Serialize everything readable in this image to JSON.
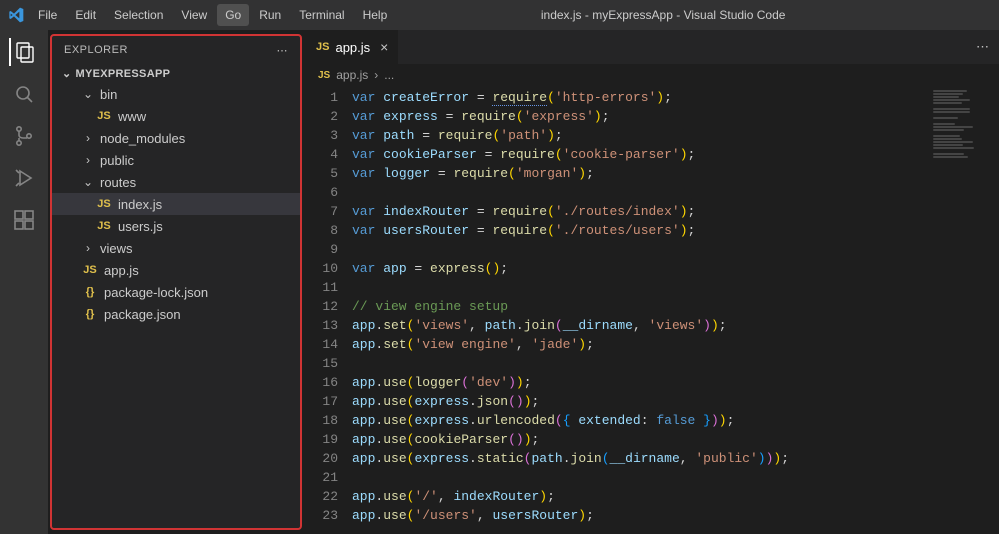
{
  "titlebar": {
    "menus": [
      "File",
      "Edit",
      "Selection",
      "View",
      "Go",
      "Run",
      "Terminal",
      "Help"
    ],
    "active_menu": "Go",
    "title": "index.js - myExpressApp - Visual Studio Code"
  },
  "activitybar": {
    "items": [
      {
        "name": "explorer",
        "active": true
      },
      {
        "name": "search",
        "active": false
      },
      {
        "name": "source-control",
        "active": false
      },
      {
        "name": "run-debug",
        "active": false
      },
      {
        "name": "extensions",
        "active": false
      }
    ]
  },
  "sidebar": {
    "title": "EXPLORER",
    "project": "MYEXPRESSAPP",
    "tree": [
      {
        "type": "folder",
        "name": "bin",
        "open": true,
        "depth": 1
      },
      {
        "type": "file",
        "name": "www",
        "lang": "js",
        "depth": 2
      },
      {
        "type": "folder",
        "name": "node_modules",
        "open": false,
        "depth": 1
      },
      {
        "type": "folder",
        "name": "public",
        "open": false,
        "depth": 1
      },
      {
        "type": "folder",
        "name": "routes",
        "open": true,
        "depth": 1
      },
      {
        "type": "file",
        "name": "index.js",
        "lang": "js",
        "depth": 2,
        "selected": true
      },
      {
        "type": "file",
        "name": "users.js",
        "lang": "js",
        "depth": 2
      },
      {
        "type": "folder",
        "name": "views",
        "open": false,
        "depth": 1
      },
      {
        "type": "file",
        "name": "app.js",
        "lang": "js",
        "depth": 1
      },
      {
        "type": "file",
        "name": "package-lock.json",
        "lang": "json",
        "depth": 1
      },
      {
        "type": "file",
        "name": "package.json",
        "lang": "json",
        "depth": 1
      }
    ]
  },
  "tabs": {
    "open": [
      {
        "label": "app.js",
        "lang": "js",
        "active": true
      }
    ]
  },
  "breadcrumb": {
    "file": "app.js",
    "sep": "›",
    "rest": "..."
  },
  "code": {
    "start_line": 1,
    "lines": [
      [
        [
          "kw",
          "var"
        ],
        [
          "p",
          " "
        ],
        [
          "var",
          "createError"
        ],
        [
          "p",
          " = "
        ],
        [
          "fn-sq",
          "require"
        ],
        [
          "brk1",
          "("
        ],
        [
          "str",
          "'http-errors'"
        ],
        [
          "brk1",
          ")"
        ],
        [
          "p",
          ";"
        ]
      ],
      [
        [
          "kw",
          "var"
        ],
        [
          "p",
          " "
        ],
        [
          "var",
          "express"
        ],
        [
          "p",
          " = "
        ],
        [
          "fn",
          "require"
        ],
        [
          "brk1",
          "("
        ],
        [
          "str",
          "'express'"
        ],
        [
          "brk1",
          ")"
        ],
        [
          "p",
          ";"
        ]
      ],
      [
        [
          "kw",
          "var"
        ],
        [
          "p",
          " "
        ],
        [
          "var",
          "path"
        ],
        [
          "p",
          " = "
        ],
        [
          "fn",
          "require"
        ],
        [
          "brk1",
          "("
        ],
        [
          "str",
          "'path'"
        ],
        [
          "brk1",
          ")"
        ],
        [
          "p",
          ";"
        ]
      ],
      [
        [
          "kw",
          "var"
        ],
        [
          "p",
          " "
        ],
        [
          "var",
          "cookieParser"
        ],
        [
          "p",
          " = "
        ],
        [
          "fn",
          "require"
        ],
        [
          "brk1",
          "("
        ],
        [
          "str",
          "'cookie-parser'"
        ],
        [
          "brk1",
          ")"
        ],
        [
          "p",
          ";"
        ]
      ],
      [
        [
          "kw",
          "var"
        ],
        [
          "p",
          " "
        ],
        [
          "var",
          "logger"
        ],
        [
          "p",
          " = "
        ],
        [
          "fn",
          "require"
        ],
        [
          "brk1",
          "("
        ],
        [
          "str",
          "'morgan'"
        ],
        [
          "brk1",
          ")"
        ],
        [
          "p",
          ";"
        ]
      ],
      [],
      [
        [
          "kw",
          "var"
        ],
        [
          "p",
          " "
        ],
        [
          "var",
          "indexRouter"
        ],
        [
          "p",
          " = "
        ],
        [
          "fn",
          "require"
        ],
        [
          "brk1",
          "("
        ],
        [
          "str",
          "'./routes/index'"
        ],
        [
          "brk1",
          ")"
        ],
        [
          "p",
          ";"
        ]
      ],
      [
        [
          "kw",
          "var"
        ],
        [
          "p",
          " "
        ],
        [
          "var",
          "usersRouter"
        ],
        [
          "p",
          " = "
        ],
        [
          "fn",
          "require"
        ],
        [
          "brk1",
          "("
        ],
        [
          "str",
          "'./routes/users'"
        ],
        [
          "brk1",
          ")"
        ],
        [
          "p",
          ";"
        ]
      ],
      [],
      [
        [
          "kw",
          "var"
        ],
        [
          "p",
          " "
        ],
        [
          "var",
          "app"
        ],
        [
          "p",
          " = "
        ],
        [
          "fn",
          "express"
        ],
        [
          "brk1",
          "("
        ],
        [
          "brk1",
          ")"
        ],
        [
          "p",
          ";"
        ]
      ],
      [],
      [
        [
          "cm",
          "// view engine setup"
        ]
      ],
      [
        [
          "var",
          "app"
        ],
        [
          "p",
          "."
        ],
        [
          "fn",
          "set"
        ],
        [
          "brk1",
          "("
        ],
        [
          "str",
          "'views'"
        ],
        [
          "p",
          ", "
        ],
        [
          "var",
          "path"
        ],
        [
          "p",
          "."
        ],
        [
          "fn",
          "join"
        ],
        [
          "brk2",
          "("
        ],
        [
          "var",
          "__dirname"
        ],
        [
          "p",
          ", "
        ],
        [
          "str",
          "'views'"
        ],
        [
          "brk2",
          ")"
        ],
        [
          "brk1",
          ")"
        ],
        [
          "p",
          ";"
        ]
      ],
      [
        [
          "var",
          "app"
        ],
        [
          "p",
          "."
        ],
        [
          "fn",
          "set"
        ],
        [
          "brk1",
          "("
        ],
        [
          "str",
          "'view engine'"
        ],
        [
          "p",
          ", "
        ],
        [
          "str",
          "'jade'"
        ],
        [
          "brk1",
          ")"
        ],
        [
          "p",
          ";"
        ]
      ],
      [],
      [
        [
          "var",
          "app"
        ],
        [
          "p",
          "."
        ],
        [
          "fn",
          "use"
        ],
        [
          "brk1",
          "("
        ],
        [
          "fn",
          "logger"
        ],
        [
          "brk2",
          "("
        ],
        [
          "str",
          "'dev'"
        ],
        [
          "brk2",
          ")"
        ],
        [
          "brk1",
          ")"
        ],
        [
          "p",
          ";"
        ]
      ],
      [
        [
          "var",
          "app"
        ],
        [
          "p",
          "."
        ],
        [
          "fn",
          "use"
        ],
        [
          "brk1",
          "("
        ],
        [
          "var",
          "express"
        ],
        [
          "p",
          "."
        ],
        [
          "fn",
          "json"
        ],
        [
          "brk2",
          "("
        ],
        [
          "brk2",
          ")"
        ],
        [
          "brk1",
          ")"
        ],
        [
          "p",
          ";"
        ]
      ],
      [
        [
          "var",
          "app"
        ],
        [
          "p",
          "."
        ],
        [
          "fn",
          "use"
        ],
        [
          "brk1",
          "("
        ],
        [
          "var",
          "express"
        ],
        [
          "p",
          "."
        ],
        [
          "fn",
          "urlencoded"
        ],
        [
          "brk2",
          "("
        ],
        [
          "brk3",
          "{"
        ],
        [
          "p",
          " "
        ],
        [
          "var",
          "extended"
        ],
        [
          "p",
          ": "
        ],
        [
          "bl",
          "false"
        ],
        [
          "p",
          " "
        ],
        [
          "brk3",
          "}"
        ],
        [
          "brk2",
          ")"
        ],
        [
          "brk1",
          ")"
        ],
        [
          "p",
          ";"
        ]
      ],
      [
        [
          "var",
          "app"
        ],
        [
          "p",
          "."
        ],
        [
          "fn",
          "use"
        ],
        [
          "brk1",
          "("
        ],
        [
          "fn",
          "cookieParser"
        ],
        [
          "brk2",
          "("
        ],
        [
          "brk2",
          ")"
        ],
        [
          "brk1",
          ")"
        ],
        [
          "p",
          ";"
        ]
      ],
      [
        [
          "var",
          "app"
        ],
        [
          "p",
          "."
        ],
        [
          "fn",
          "use"
        ],
        [
          "brk1",
          "("
        ],
        [
          "var",
          "express"
        ],
        [
          "p",
          "."
        ],
        [
          "fn",
          "static"
        ],
        [
          "brk2",
          "("
        ],
        [
          "var",
          "path"
        ],
        [
          "p",
          "."
        ],
        [
          "fn",
          "join"
        ],
        [
          "brk3",
          "("
        ],
        [
          "var",
          "__dirname"
        ],
        [
          "p",
          ", "
        ],
        [
          "str",
          "'public'"
        ],
        [
          "brk3",
          ")"
        ],
        [
          "brk2",
          ")"
        ],
        [
          "brk1",
          ")"
        ],
        [
          "p",
          ";"
        ]
      ],
      [],
      [
        [
          "var",
          "app"
        ],
        [
          "p",
          "."
        ],
        [
          "fn",
          "use"
        ],
        [
          "brk1",
          "("
        ],
        [
          "str",
          "'/'"
        ],
        [
          "p",
          ", "
        ],
        [
          "var",
          "indexRouter"
        ],
        [
          "brk1",
          ")"
        ],
        [
          "p",
          ";"
        ]
      ],
      [
        [
          "var",
          "app"
        ],
        [
          "p",
          "."
        ],
        [
          "fn",
          "use"
        ],
        [
          "brk1",
          "("
        ],
        [
          "str",
          "'/users'"
        ],
        [
          "p",
          ", "
        ],
        [
          "var",
          "usersRouter"
        ],
        [
          "brk1",
          ")"
        ],
        [
          "p",
          ";"
        ]
      ]
    ]
  }
}
